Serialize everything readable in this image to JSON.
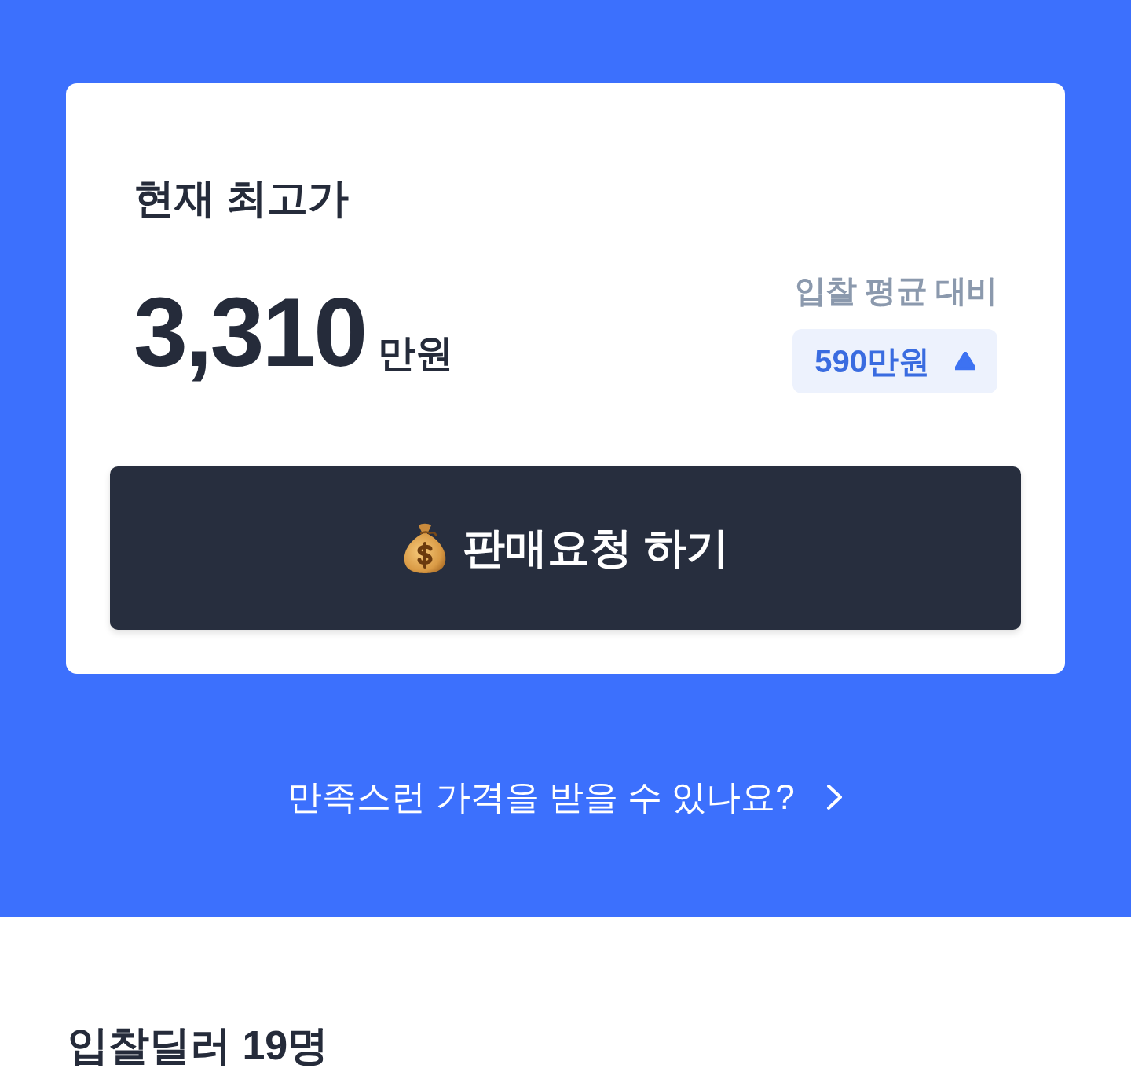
{
  "price_card": {
    "title": "현재 최고가",
    "price": {
      "amount": "3,310",
      "unit": "만원"
    },
    "comparison": {
      "label": "입찰 평균 대비",
      "difference": "590만원",
      "increase": true
    },
    "sell_button": {
      "label": "판매요청 하기"
    }
  },
  "help_link": {
    "label": "만족스런 가격을 받을 수 있나요?"
  },
  "dealers_section": {
    "title": "입찰딜러 19명"
  }
}
